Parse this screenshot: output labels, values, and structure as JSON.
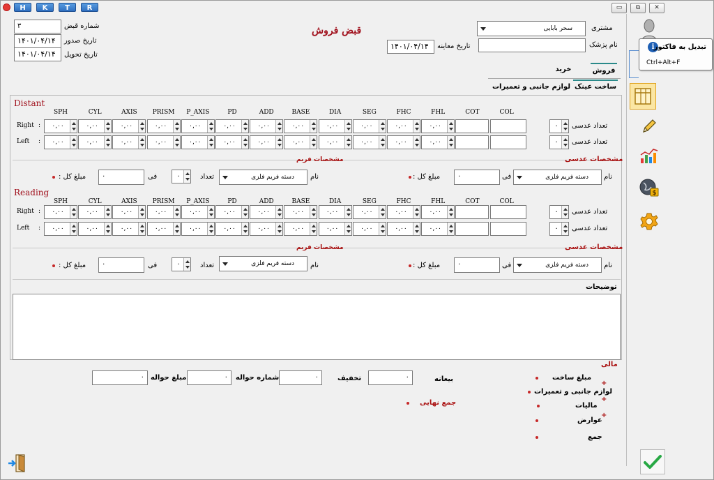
{
  "titlebar": {
    "lang_buttons": [
      "H",
      "K",
      "T",
      "R"
    ],
    "minimize": "▭",
    "restore": "⧉",
    "close": "✕"
  },
  "header": {
    "title": "قبض فروش",
    "receipt_no_label": "شماره قبض",
    "receipt_no": "۳",
    "issue_date_label": "تاریخ صدور",
    "issue_date": "۱۴۰۱/۰۴/۱۴",
    "delivery_date_label": "تاریخ تحویل",
    "delivery_date": "۱۴۰۱/۰۴/۱۴",
    "customer_label": "مشتری",
    "customer": "سحر بابایی",
    "doctor_label": "نام پزشک",
    "doctor": "",
    "exam_date_label": "تاریخ معاینه",
    "exam_date": "۱۴۰۱/۰۴/۱۴"
  },
  "tabs": {
    "top": [
      "فروش",
      "خرید"
    ],
    "sub": [
      "ساخت عینک",
      "لوازم جانبی و تعمیرات"
    ]
  },
  "columns": [
    "SPH",
    "CYL",
    "AXIS",
    "PRISM",
    "P_AXIS",
    "PD",
    "ADD",
    "BASE",
    "DIA",
    "SEG",
    "FHC",
    "FHL",
    "COT",
    "COL"
  ],
  "spin_value": "۰,۰۰",
  "distant": {
    "title": "Distant",
    "right_label": "Right",
    "left_label": "Left",
    "colon": ":",
    "lens_count_label": "تعداد عدسی",
    "lens_count": "۰",
    "lens_spec_label": "مشخصات عدسی",
    "frame_spec_label": "مشخصات فریم",
    "name_label": "نام",
    "lens_select": "دسته فریم فلزی",
    "fee_label": "فی",
    "fee": "۰",
    "total_label": "مبلغ کل :",
    "frame_name_label": "نام",
    "frame_select": "دسته فریم فلزی",
    "frame_count_label": "تعداد",
    "frame_count": "۰",
    "frame_fee_label": "فی",
    "frame_fee": "۰",
    "frame_total_label": "مبلغ کل :"
  },
  "reading": {
    "title": "Reading",
    "right_label": "Right",
    "left_label": "Left",
    "colon": ":",
    "lens_count_label": "تعداد عدسی",
    "lens_count": "۰",
    "lens_spec_label": "مشخصات عدسی",
    "frame_spec_label": "مشخصات فریم",
    "name_label": "نام",
    "lens_select": "دسته فریم فلزی",
    "fee_label": "فی",
    "fee": "۰",
    "total_label": "مبلغ کل :",
    "frame_name_label": "نام",
    "frame_select": "دسته فریم فلزی",
    "frame_count_label": "تعداد",
    "frame_count": "۰",
    "frame_fee_label": "فی",
    "frame_fee": "۰",
    "frame_total_label": "مبلغ کل :"
  },
  "notes": {
    "label": "توضیحات",
    "value": ""
  },
  "financial": {
    "title": "مالی",
    "build_amount": "مبلغ ساخت",
    "accessories": "لوازم جانبی و تعمیرات",
    "tax": "مالیات",
    "duties": "عوارض",
    "sum": "جمع",
    "plus": "+",
    "deposit_label": "بیعانه",
    "deposit": "۰",
    "discount_label": "تخفیف",
    "discount": "۰",
    "transfer_no_label": "شماره حواله",
    "transfer_no": "۰",
    "transfer_amount_label": "مبلغ حواله",
    "transfer_amount": "۰",
    "final_total_label": "جمع نهایی"
  },
  "tooltip": {
    "title": "تبدیل به فاکتور",
    "shortcut": "Ctrl+Alt+F",
    "info": "i"
  },
  "colors": {
    "accent_red": "#a0101c",
    "tab_accent": "#2a8a8a",
    "active_tool": "#fbe6a3"
  }
}
